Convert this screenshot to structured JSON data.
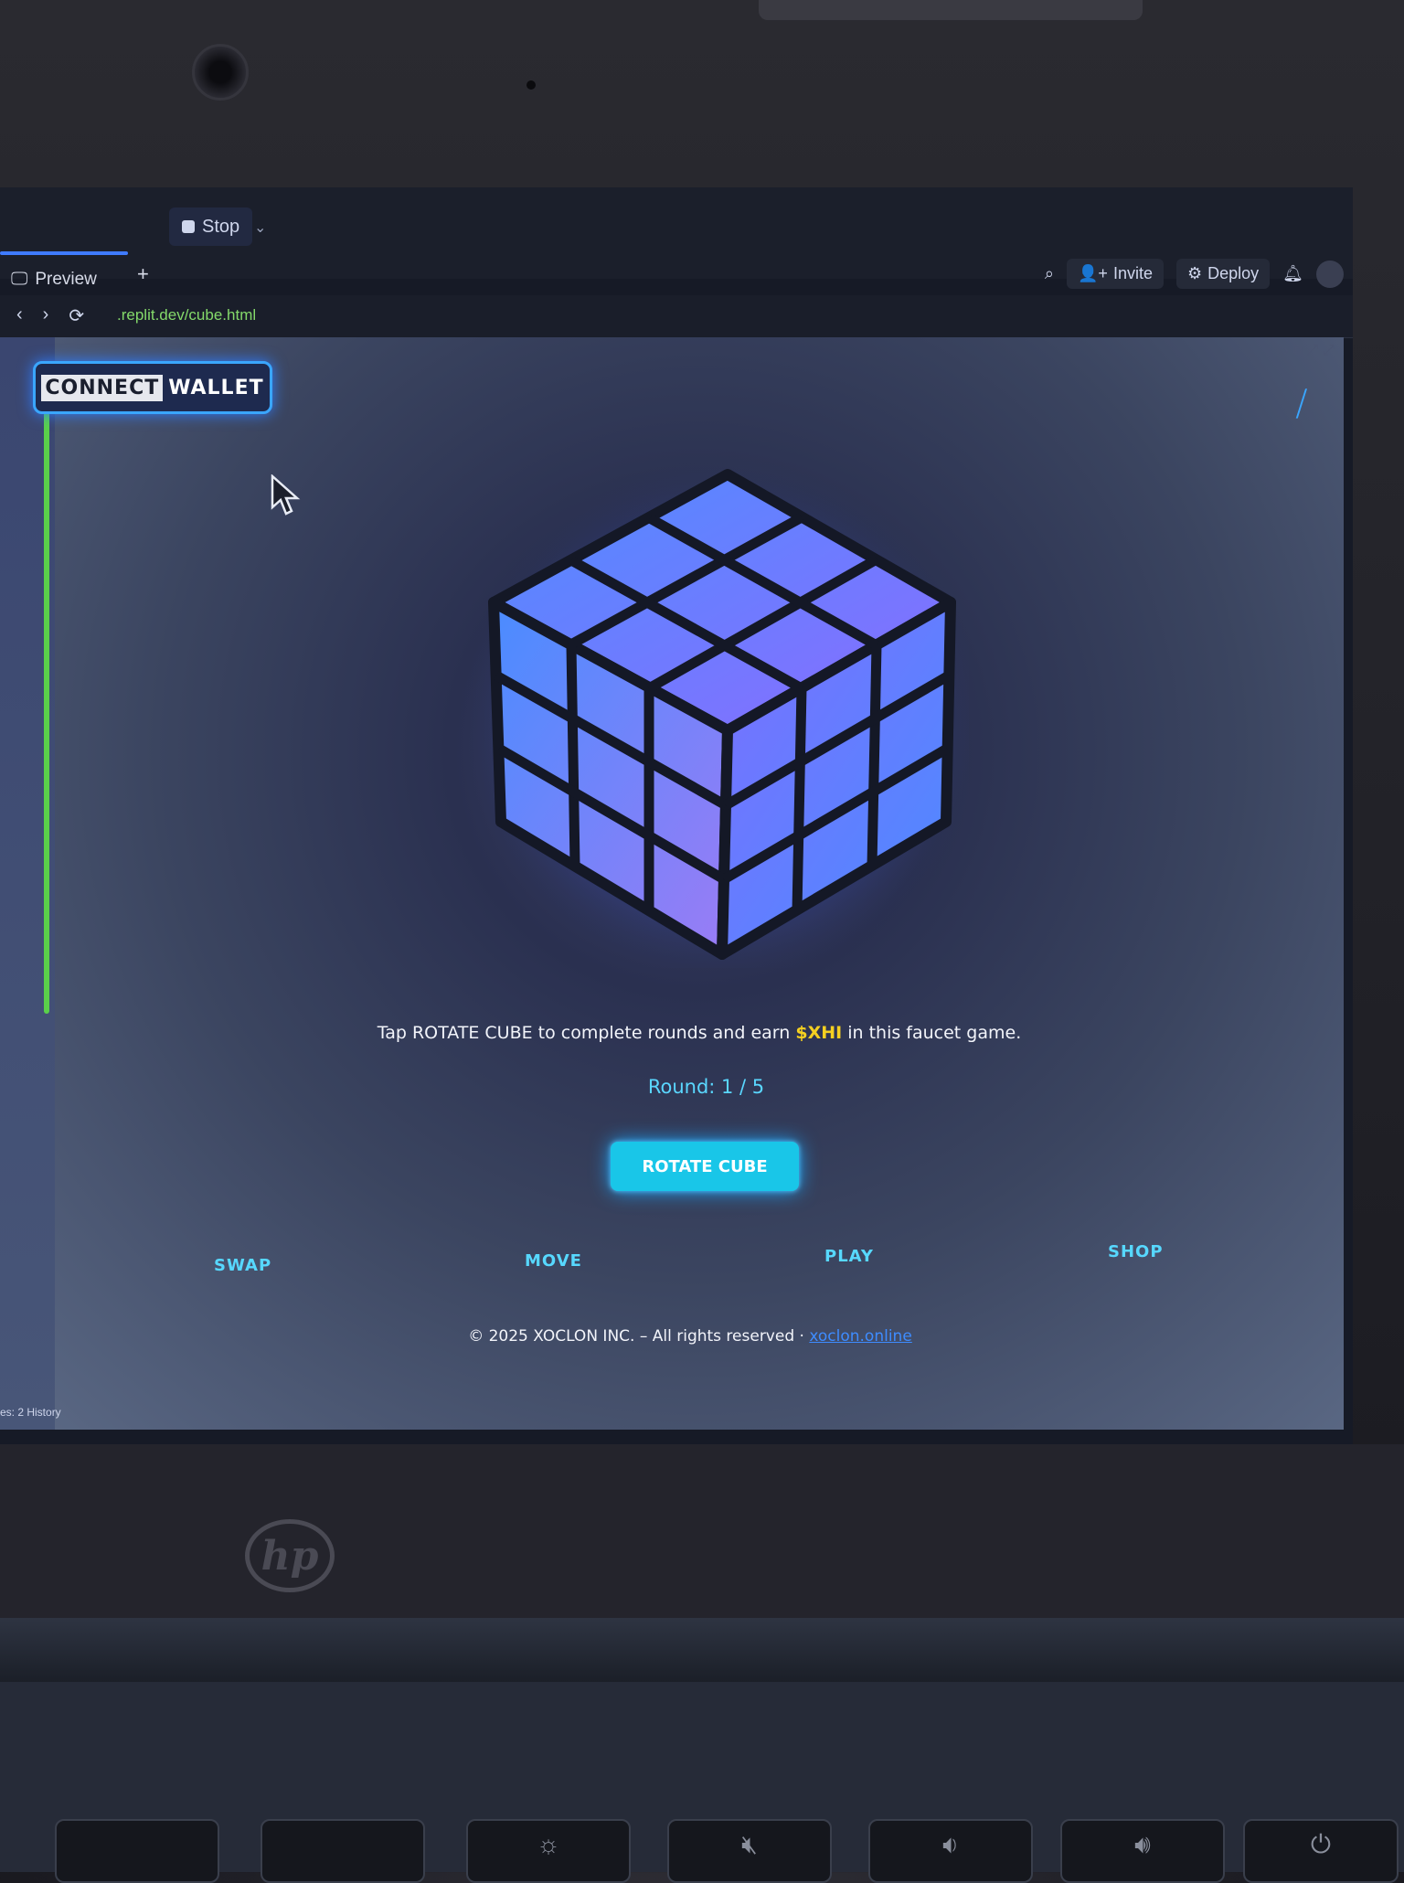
{
  "ide": {
    "stop_label": "Stop",
    "preview_tab": "Preview",
    "invite_label": "Invite",
    "deploy_label": "Deploy",
    "url": ".replit.dev/cube.html",
    "side_footer": "es: 2   History"
  },
  "app": {
    "connect_label": "CONNECT",
    "wallet_label": "WALLET",
    "description_prefix": "Tap ROTATE CUBE to complete rounds and earn ",
    "token": "$XHI",
    "description_suffix": " in this faucet game.",
    "round_text": "Round: 1 / 5",
    "rotate_button": "ROTATE CUBE",
    "nav": [
      "SWAP",
      "MOVE",
      "PLAY",
      "SHOP"
    ],
    "footer_text": "© 2025 XOCLON INC. – All rights reserved · ",
    "footer_link": "xoclon.online"
  },
  "hardware": {
    "brand": "hp"
  },
  "colors": {
    "accent": "#19c6e8",
    "token": "#f5d021",
    "wallet_border": "#3aa6ff"
  }
}
